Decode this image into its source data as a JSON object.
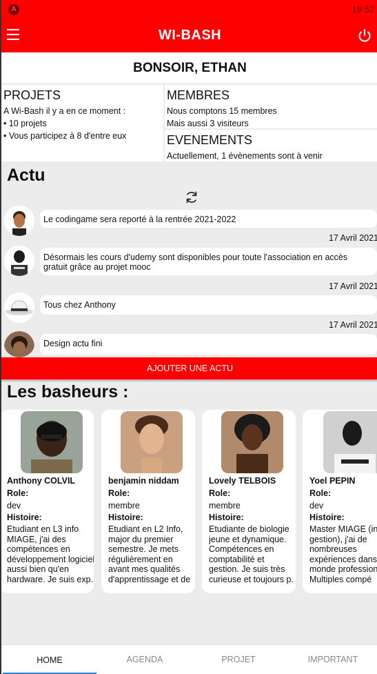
{
  "status_bar": {
    "time": "19:52",
    "app_badge": "A"
  },
  "header": {
    "title": "WI-BASH"
  },
  "greeting": "BONSOIR, ETHAN",
  "projets": {
    "title": "PROJETS",
    "line1": "A Wi-Bash il y a en ce moment  :",
    "line2": "• 10 projets",
    "line3": "• Vous participez à 8 d'entre eux"
  },
  "membres": {
    "title": "MEMBRES",
    "line1": "Nous comptons 15 membres",
    "line2": "Mais aussi 3 visiteurs"
  },
  "evenements": {
    "title": "EVENEMENTS",
    "line1": "Actuellement, 1  évènements sont à venir"
  },
  "actu": {
    "title": "Actu",
    "items": [
      {
        "text": "Le codingame sera reporté à la rentrée 2021-2022",
        "date": "17 Avril 2021"
      },
      {
        "text": "Désormais les cours d'udemy sont disponibles pour toute l'association en accès gratuit grâce au projet mooc",
        "date": "17 Avril 2021"
      },
      {
        "text": "Tous chez Anthony",
        "date": "17 Avril 2021"
      },
      {
        "text": "Design actu fini",
        "date": ""
      }
    ],
    "add_button": "AJOUTER UNE ACTU"
  },
  "basheurs": {
    "title": "Les basheurs :",
    "role_label": "Role:",
    "histoire_label": "Histoire:",
    "people": [
      {
        "name": "Anthony COLVIL",
        "role": "dev",
        "histoire": "Etudiant en L3 info MIAGE, j'ai des compétences en développement logiciel aussi bien qu'en hardware. Je suis exp."
      },
      {
        "name": "benjamin niddam",
        "role": "membre",
        "histoire": "Etudiant en L2 Info, major du premier semestre. Je mets régulièrement en avant mes qualités d'apprentissage et de ."
      },
      {
        "name": "Lovely TELBOIS",
        "role": "membre",
        "histoire": "Etudiante de biologie jeune et dynamique. Compétences en comptabilité et gestion. Je suis très curieuse et toujours p."
      },
      {
        "name": "Yoel PEPIN",
        "role": "dev",
        "histoire": "Master MIAGE (info gestion), j'ai de nombreuses expériences dans le monde professionnel. Multiples compé"
      }
    ]
  },
  "nav": {
    "tabs": [
      "HOME",
      "AGENDA",
      "PROJET",
      "IMPORTANT"
    ]
  },
  "colors": {
    "primary": "#ff0000",
    "background": "#ececec",
    "active_tab": "#2a7fd4"
  }
}
